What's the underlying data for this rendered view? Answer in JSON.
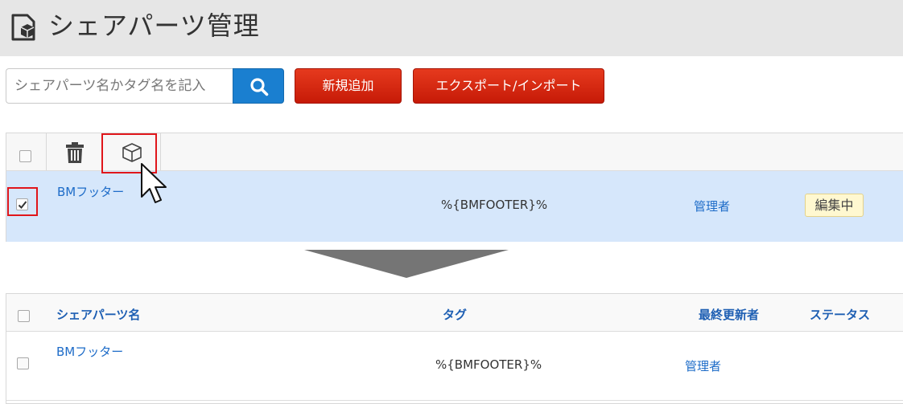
{
  "header": {
    "title": "シェアパーツ管理"
  },
  "search": {
    "placeholder": "シェアパーツ名かタグ名を記入"
  },
  "buttons": {
    "new": "新規追加",
    "export": "エクスポート/インポート"
  },
  "top_table": {
    "row": {
      "name": "BMフッター",
      "tag": "%{BMFOOTER}%",
      "updater": "管理者",
      "status": "編集中",
      "checked": true
    }
  },
  "bottom_table": {
    "headers": {
      "name": "シェアパーツ名",
      "tag": "タグ",
      "updater": "最終更新者",
      "status": "ステータス"
    },
    "row": {
      "name": "BMフッター",
      "tag": "%{BMFOOTER}%",
      "updater": "管理者",
      "status": ""
    }
  },
  "colors": {
    "accent_red": "#d42a10",
    "search_blue": "#1a7fd0",
    "link_blue": "#1e6cc8",
    "highlight_red": "#e0161b"
  }
}
